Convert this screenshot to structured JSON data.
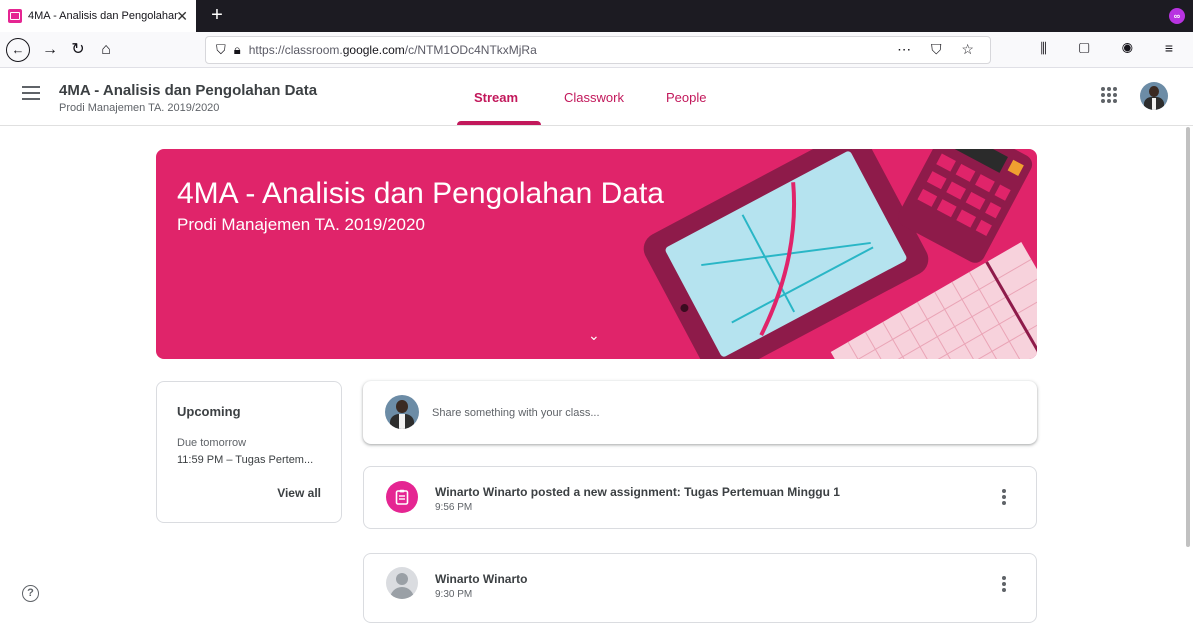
{
  "browser": {
    "tab_title": "4MA - Analisis dan Pengolahan",
    "tab_close": "✕",
    "new_tab": "+",
    "url_prefix": "https://classroom.",
    "url_domain": "google.com",
    "url_path": "/c/NTM1ODc4NTkxMjRa",
    "icons": [
      "back-icon",
      "forward-icon",
      "reload-icon",
      "home-icon",
      "shield-icon",
      "lock-icon",
      "key-icon",
      "page-actions-icon",
      "pocket-icon",
      "bookmark-star-icon",
      "library-icon",
      "sidebar-icon",
      "account-icon",
      "menu-icon"
    ]
  },
  "header": {
    "title": "4MA - Analisis dan Pengolahan Data",
    "subtitle": "Prodi Manajemen TA. 2019/2020",
    "tabs": [
      {
        "label": "Stream",
        "active": true
      },
      {
        "label": "Classwork",
        "active": false
      },
      {
        "label": "People",
        "active": false
      }
    ],
    "accent": "#c2185b"
  },
  "banner": {
    "title": "4MA - Analisis dan Pengolahan Data",
    "subtitle": "Prodi Manajemen TA. 2019/2020",
    "color": "#e0246a"
  },
  "upcoming": {
    "title": "Upcoming",
    "due": "Due tomorrow",
    "item": "11:59 PM – Tugas Pertem...",
    "view_all": "View all"
  },
  "share": {
    "placeholder": "Share something with your class..."
  },
  "stream": [
    {
      "title": "Winarto Winarto posted a new assignment: Tugas Pertemuan Minggu 1",
      "time": "9:56 PM",
      "type": "assignment"
    },
    {
      "title": "Winarto Winarto",
      "time": "9:30 PM",
      "type": "post"
    }
  ],
  "help": "?"
}
